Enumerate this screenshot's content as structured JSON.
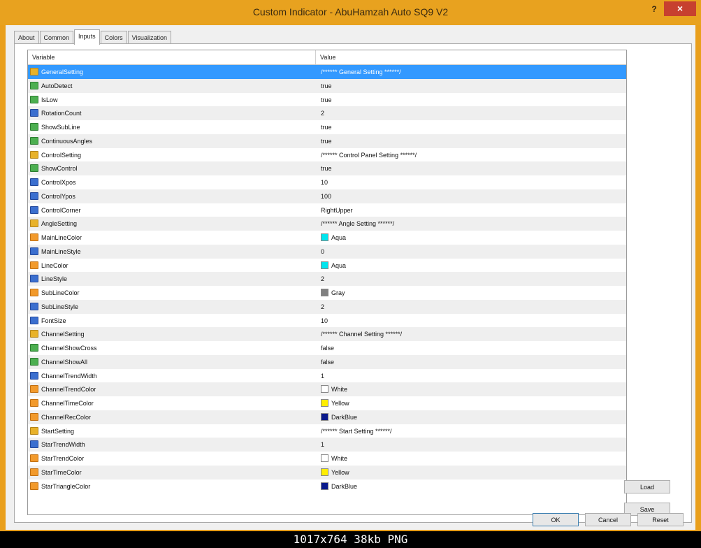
{
  "window": {
    "title": "Custom Indicator - AbuHamzah Auto SQ9 V2",
    "help": "?",
    "close": "×"
  },
  "tabs": [
    "About",
    "Common",
    "Inputs",
    "Colors",
    "Visualization"
  ],
  "active_tab": "Inputs",
  "grid": {
    "headers": {
      "variable": "Variable",
      "value": "Value"
    },
    "rows": [
      {
        "type": "str",
        "name": "GeneralSetting",
        "value": "/****** General Setting ******/"
      },
      {
        "type": "bool",
        "name": "AutoDetect",
        "value": "true"
      },
      {
        "type": "bool",
        "name": "IsLow",
        "value": "true"
      },
      {
        "type": "int",
        "name": "RotationCount",
        "value": "2"
      },
      {
        "type": "bool",
        "name": "ShowSubLine",
        "value": "true"
      },
      {
        "type": "bool",
        "name": "ContinuousAngles",
        "value": "true"
      },
      {
        "type": "str",
        "name": "ControlSetting",
        "value": "/****** Control Panel Setting ******/"
      },
      {
        "type": "bool",
        "name": "ShowControl",
        "value": "true"
      },
      {
        "type": "int",
        "name": "ControlXpos",
        "value": "10"
      },
      {
        "type": "int",
        "name": "ControlYpos",
        "value": "100"
      },
      {
        "type": "int",
        "name": "ControlCorner",
        "value": "RightUpper"
      },
      {
        "type": "str",
        "name": "AngleSetting",
        "value": "/****** Angle Setting ******/"
      },
      {
        "type": "color",
        "name": "MainLineColor",
        "value": "Aqua",
        "swatch": "#00e5ee"
      },
      {
        "type": "int",
        "name": "MainLineStyle",
        "value": "0"
      },
      {
        "type": "color",
        "name": "LineColor",
        "value": "Aqua",
        "swatch": "#00e5ee"
      },
      {
        "type": "int",
        "name": "LineStyle",
        "value": "2"
      },
      {
        "type": "color",
        "name": "SubLineColor",
        "value": "Gray",
        "swatch": "#808080"
      },
      {
        "type": "int",
        "name": "SubLineStyle",
        "value": "2"
      },
      {
        "type": "int",
        "name": "FontSize",
        "value": "10"
      },
      {
        "type": "str",
        "name": "ChannelSetting",
        "value": "/****** Channel Setting ******/"
      },
      {
        "type": "bool",
        "name": "ChannelShowCross",
        "value": "false"
      },
      {
        "type": "bool",
        "name": "ChannelShowAll",
        "value": "false"
      },
      {
        "type": "int",
        "name": "ChannelTrendWidth",
        "value": "1"
      },
      {
        "type": "color",
        "name": "ChannelTrendColor",
        "value": "White",
        "swatch": "#ffffff"
      },
      {
        "type": "color",
        "name": "ChannelTimeColor",
        "value": "Yellow",
        "swatch": "#ffee00"
      },
      {
        "type": "color",
        "name": "ChannelRecColor",
        "value": "DarkBlue",
        "swatch": "#0a1a8c"
      },
      {
        "type": "str",
        "name": "StartSetting",
        "value": "/****** Start Setting ******/"
      },
      {
        "type": "int",
        "name": "StarTrendWidth",
        "value": "1"
      },
      {
        "type": "color",
        "name": "StarTrendColor",
        "value": "White",
        "swatch": "#ffffff"
      },
      {
        "type": "color",
        "name": "StarTimeColor",
        "value": "Yellow",
        "swatch": "#ffee00"
      },
      {
        "type": "color",
        "name": "StarTriangleColor",
        "value": "DarkBlue",
        "swatch": "#0a1a8c"
      }
    ]
  },
  "buttons": {
    "load": "Load",
    "save": "Save",
    "ok": "OK",
    "cancel": "Cancel",
    "reset": "Reset"
  },
  "caption": "1017x764  38kb  PNG",
  "colors": {
    "titlebar": "#e8a21f",
    "selection": "#3399ff",
    "close": "#c7402f"
  }
}
